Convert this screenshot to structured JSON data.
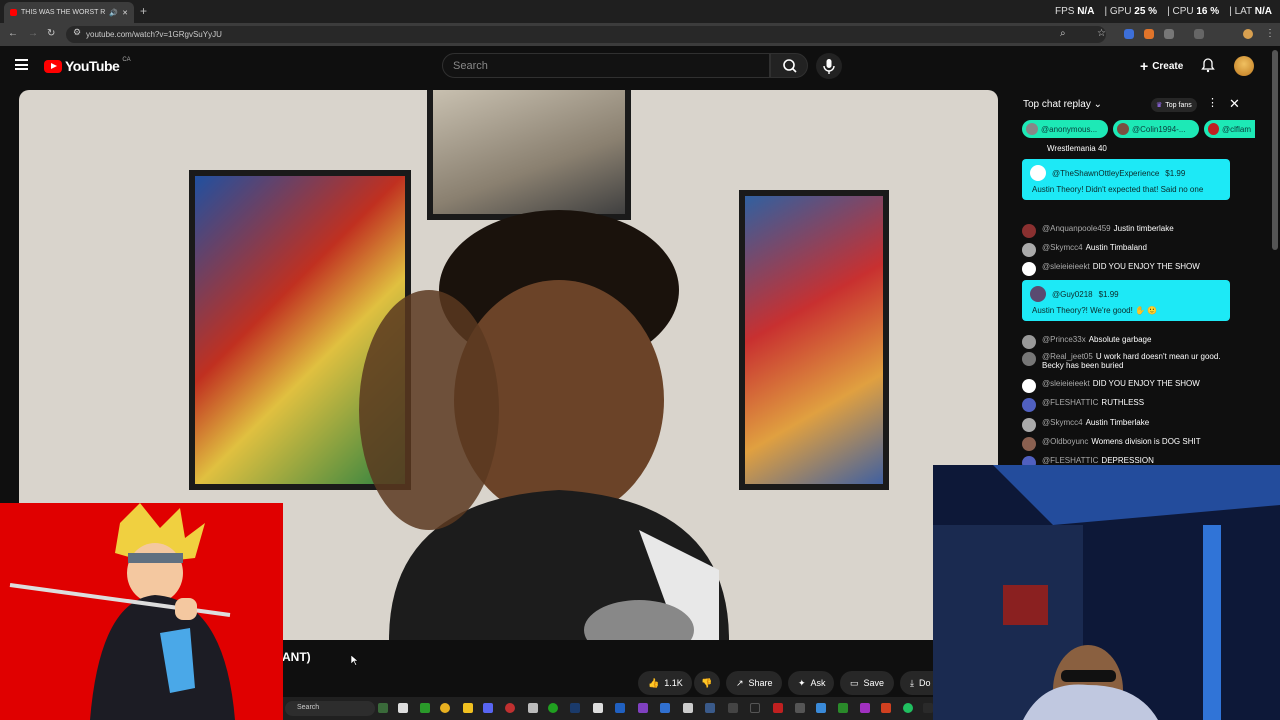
{
  "browser": {
    "tab_title": "THIS WAS THE WORST RAW",
    "url": "youtube.com/watch?v=1GRgvSuYyJU",
    "overlay": {
      "fps_label": "FPS",
      "fps_value": "N/A",
      "gpu_label": "GPU",
      "gpu_value": "25 %",
      "cpu_label": "CPU",
      "cpu_value": "16 %",
      "lat_label": "LAT",
      "lat_value": "N/A"
    }
  },
  "youtube": {
    "logo_text": "YouTube",
    "region": "CA",
    "search_placeholder": "Search",
    "create_label": "Create"
  },
  "video": {
    "title_visible": "ANT)"
  },
  "actions": {
    "likes": "1.1K",
    "share": "Share",
    "ask": "Ask",
    "save": "Save",
    "download_partial": "Do"
  },
  "chat": {
    "title": "Top chat replay",
    "top_fans": "Top fans",
    "fan_chips": [
      "@anonymous...",
      "@Colin1994-...",
      "@clflam"
    ],
    "first_line": "Wrestlemania 40",
    "superchat_1": {
      "author": "@TheShawnOttleyExperience",
      "amount": "$1.99",
      "text": "Austin Theory! Didn't expected that! Said no one"
    },
    "messages_a": [
      {
        "author": "@Anquanpoole459",
        "text": "Justin timberlake"
      },
      {
        "author": "@Skymcc4",
        "text": "Austin Timbaland"
      },
      {
        "author": "@sleieieieekt",
        "text": "DID YOU ENJOY THE SHOW"
      }
    ],
    "superchat_2": {
      "author": "@Guy0218",
      "amount": "$1.99",
      "text": "Austin Theory?! We're good! ✋ 🙂"
    },
    "messages_b": [
      {
        "author": "@Prince33x",
        "text": "Absolute garbage"
      },
      {
        "author": "@Real_jeet05",
        "text": "U work hard doesn't mean ur good. Becky has been buried"
      },
      {
        "author": "@sleieieieekt",
        "text": "DID YOU ENJOY THE SHOW"
      },
      {
        "author": "@FLESHATTIC",
        "text": "RUTHLESS"
      },
      {
        "author": "@Skymcc4",
        "text": "Austin Timberlake"
      },
      {
        "author": "@Oldboyunc",
        "text": "Womens division is DOG SHIT"
      },
      {
        "author": "@FLESHATTIC",
        "text": "DEPRESSION"
      }
    ]
  },
  "taskbar": {
    "search_placeholder": "Search"
  },
  "colors": {
    "youtube_red": "#ff0000",
    "superchat_cyan": "#1de9f6",
    "chip_teal": "#1de9b6"
  }
}
